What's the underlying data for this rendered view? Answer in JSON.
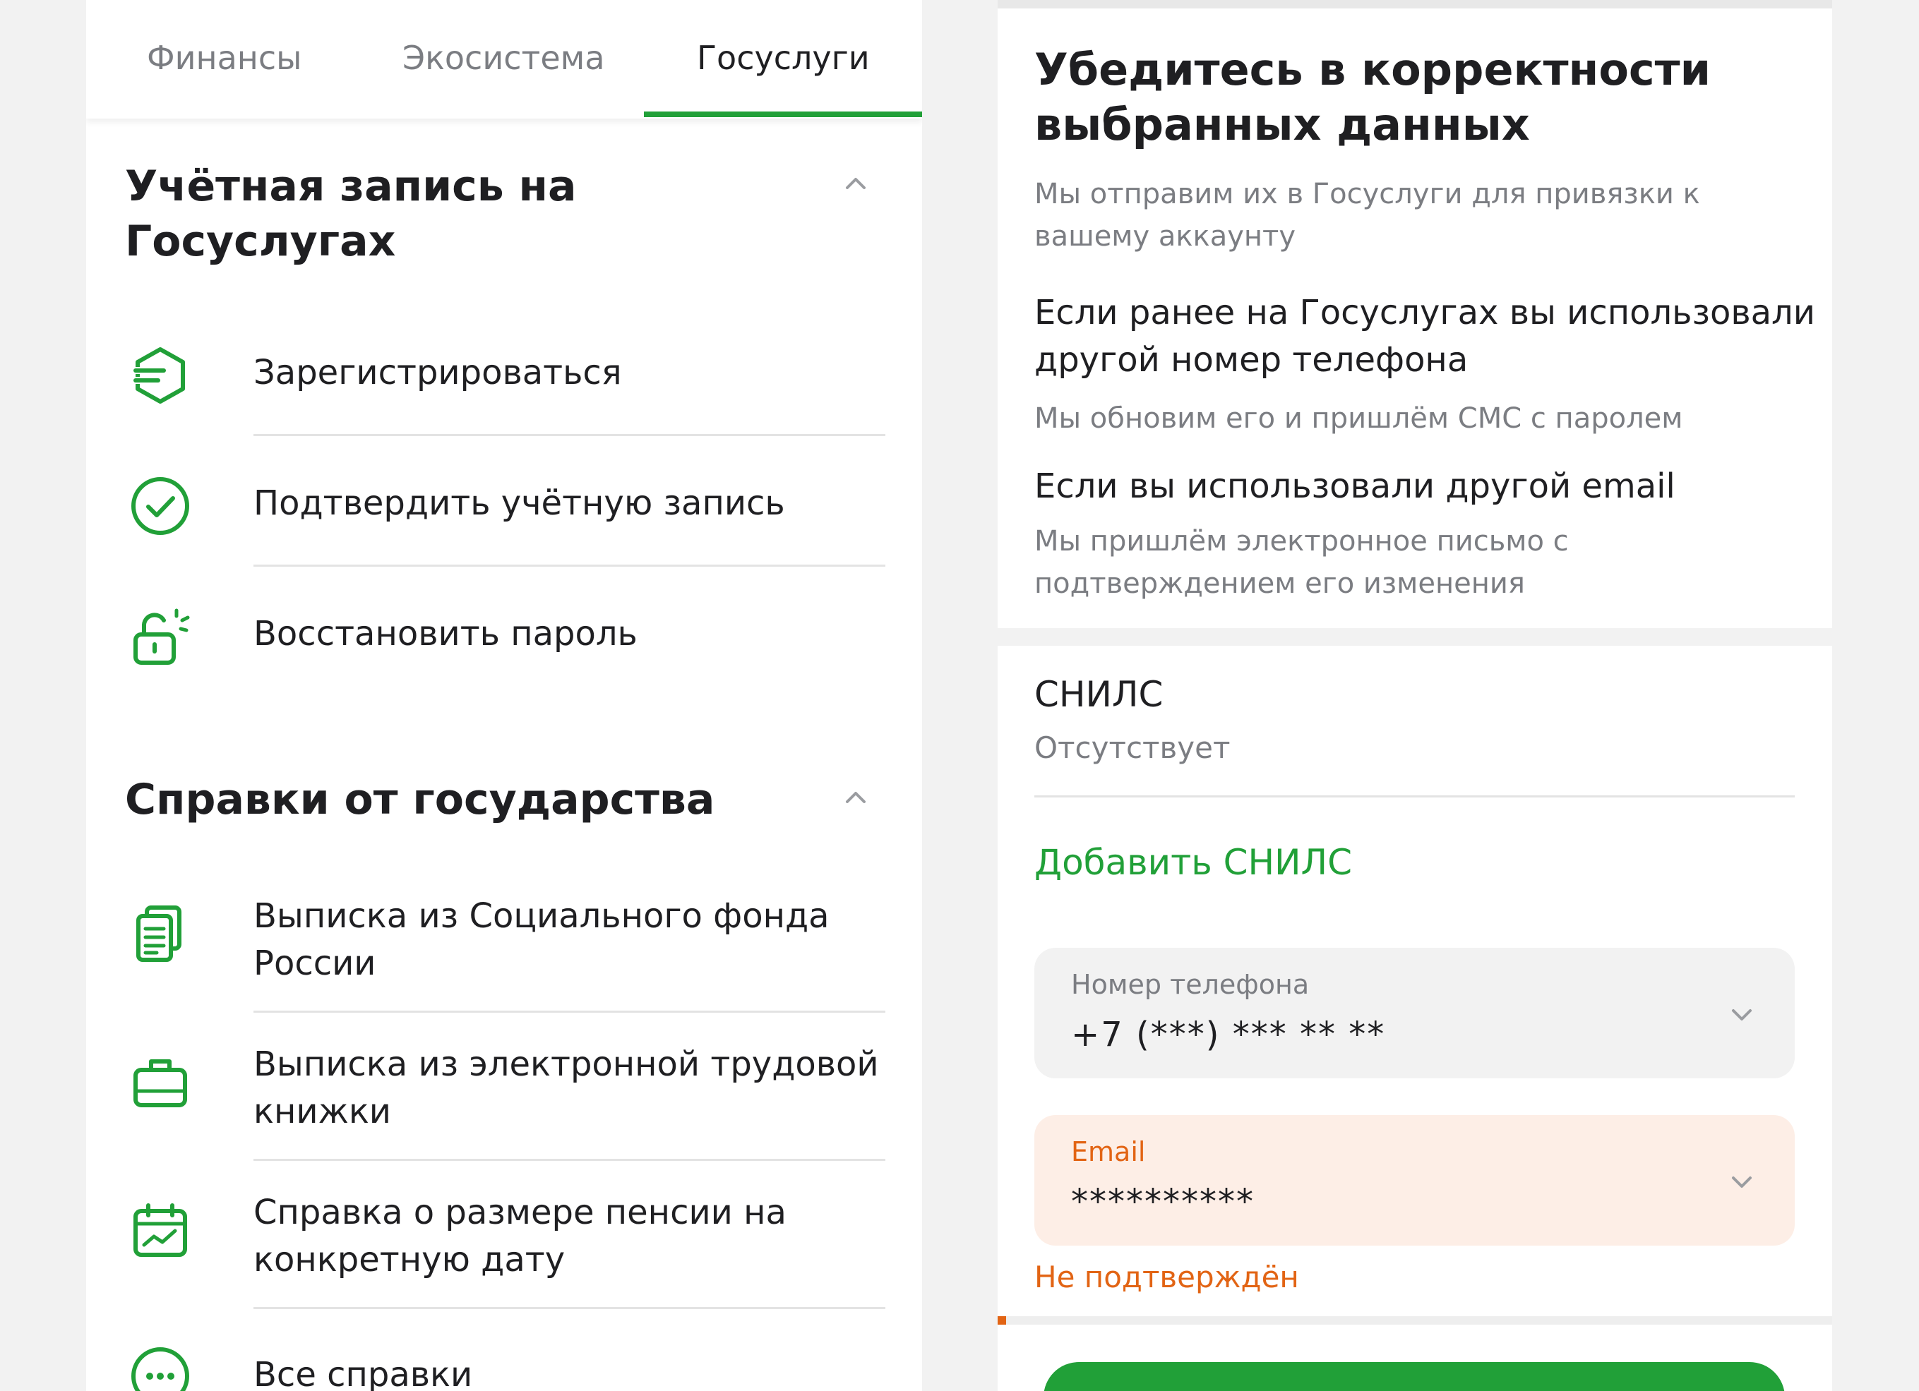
{
  "tabs": [
    {
      "label": "Финансы"
    },
    {
      "label": "Экосистема"
    },
    {
      "label": "Госуслуги",
      "active": true
    }
  ],
  "account_section": {
    "title": "Учётная запись на Госуслугах",
    "items": [
      {
        "label": "Зарегистрироваться",
        "icon": "register-icon"
      },
      {
        "label": "Подтвердить учётную запись",
        "icon": "check-circle-icon"
      },
      {
        "label": "Восстановить пароль",
        "icon": "unlock-icon"
      }
    ]
  },
  "certificates_section": {
    "title": "Справки от государства",
    "items": [
      {
        "label": "Выписка из Социального фонда России",
        "icon": "documents-icon"
      },
      {
        "label": "Выписка из электронной трудовой книжки",
        "icon": "briefcase-icon"
      },
      {
        "label": "Справка о размере пенсии на конкретную дату",
        "icon": "calendar-chart-icon"
      },
      {
        "label": "Все справки",
        "icon": "more-dots-icon"
      }
    ]
  },
  "verify": {
    "title": "Убедитесь в корректности выбранных данных",
    "subtitle": "Мы отправим их в Госуслуги для привязки к вашему аккаунту",
    "phone_note_title": "Если ранее на Госуслугах вы использовали другой номер телефона",
    "phone_note_text": "Мы обновим его и пришлём СМС с паролем",
    "email_note_title": "Если вы использовали другой email",
    "email_note_text": "Мы пришлём электронное письмо с подтверждением его изменения"
  },
  "snils": {
    "label": "СНИЛС",
    "value": "Отсутствует",
    "add_label": "Добавить СНИЛС"
  },
  "phone_field": {
    "label": "Номер телефона",
    "value": "+7 (***) *** ** **"
  },
  "email_field": {
    "label": "Email",
    "value": "**********",
    "status": "Не подтверждён"
  },
  "progress": {
    "fraction": 0.01
  },
  "colors": {
    "brand_green": "#21a038",
    "warning_orange": "#e26414",
    "muted_text": "#7b7d82"
  }
}
